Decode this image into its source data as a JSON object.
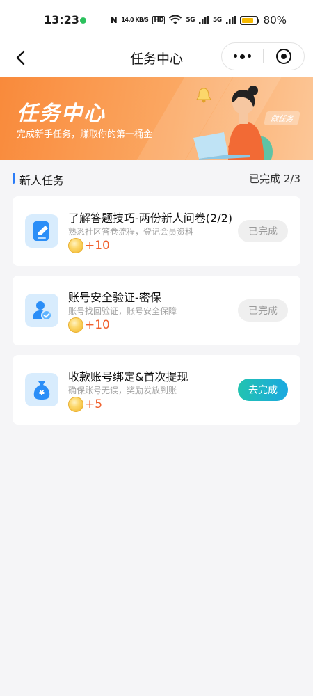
{
  "status_bar": {
    "time": "13:23",
    "net_speed": "14.0 KB/S",
    "hd": "HD",
    "signal1": "5G",
    "signal2": "5G",
    "battery": "80%",
    "battery_level": 0.8
  },
  "nav": {
    "title": "任务中心"
  },
  "banner": {
    "title": "任务中心",
    "subtitle": "完成新手任务，赚取你的第一桶金",
    "tag": "做任务"
  },
  "section": {
    "title": "新人任务",
    "progress": "已完成 2/3"
  },
  "tasks": [
    {
      "title": "了解答题技巧-两份新人问卷(2/2)",
      "desc": "熟悉社区答卷流程，登记会员资料",
      "points": "+10",
      "button": "已完成",
      "icon": "document-edit-icon"
    },
    {
      "title": "账号安全验证-密保",
      "desc": "账号找回验证，账号安全保障",
      "points": "+10",
      "button": "已完成",
      "icon": "user-verified-icon"
    },
    {
      "title": "收款账号绑定&首次提现",
      "desc": "确保账号无误，奖励发放到账",
      "points": "+5",
      "button": "去完成",
      "icon": "money-bag-icon"
    }
  ],
  "colors": {
    "accent_blue": "#2b7cf7",
    "banner_orange": "#f98a3b",
    "points_red": "#f0612e",
    "action_teal": "#22c3b0"
  }
}
